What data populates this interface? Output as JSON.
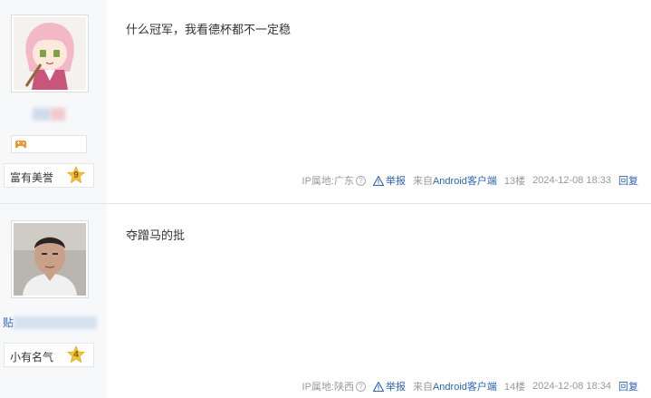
{
  "posts": [
    {
      "content": "什么冠军，我看德杯都不一定稳",
      "level_title": "富有美誉",
      "level_num": "9",
      "ip_label": "IP属地:广东",
      "report_label": "举报",
      "from_prefix": "来自",
      "from_client": "Android客户端",
      "floor": "13楼",
      "time": "2024-12-08 18:33",
      "reply_label": "回复"
    },
    {
      "content": "夺蹭马的批",
      "username_visible": "贴",
      "level_title": "小有名气",
      "level_num": "4",
      "ip_label": "IP属地:陕西",
      "report_label": "举报",
      "from_prefix": "来自",
      "from_client": "Android客户端",
      "floor": "14楼",
      "time": "2024-12-08 18:34",
      "reply_label": "回复"
    }
  ],
  "icons": {
    "help": "question-circle-icon",
    "report": "warning-triangle-icon",
    "badge": "game-controller-icon",
    "level": "star-badge-icon"
  },
  "colors": {
    "link": "#2d64b3",
    "meta": "#999999",
    "sidebar_bg": "#f7f8fa",
    "level_star": "#f5c338"
  }
}
